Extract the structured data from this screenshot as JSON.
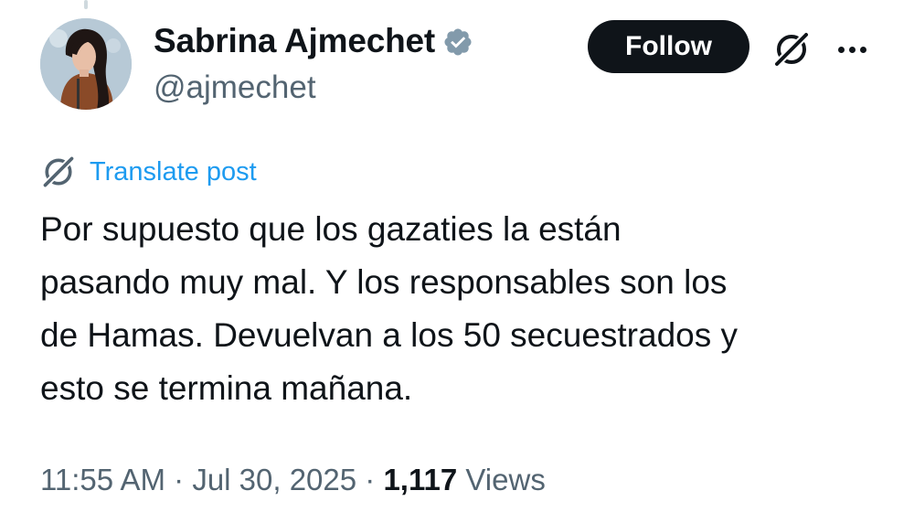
{
  "author": {
    "display_name": "Sabrina Ajmechet",
    "handle": "@ajmechet",
    "verified": true
  },
  "actions": {
    "follow_label": "Follow",
    "grok_icon": "grok-icon",
    "more_icon": "more-icon"
  },
  "translate": {
    "label": "Translate post",
    "icon": "grok-icon"
  },
  "post": {
    "lines": [
      "Por supuesto que los gazaties la están",
      "pasando muy mal. Y los responsables son los",
      "de Hamas. Devuelvan a los 50 secuestrados y",
      "esto se termina mañana."
    ]
  },
  "meta": {
    "time": "11:55 AM",
    "sep1": " · ",
    "date": "Jul 30, 2025",
    "sep2": " · ",
    "views_count": "1,117",
    "views_label": " Views"
  },
  "colors": {
    "text": "#0f1419",
    "secondary": "#536471",
    "link": "#1d9bf0",
    "verified_badge": "#829aab",
    "follow_bg": "#0f1419"
  }
}
